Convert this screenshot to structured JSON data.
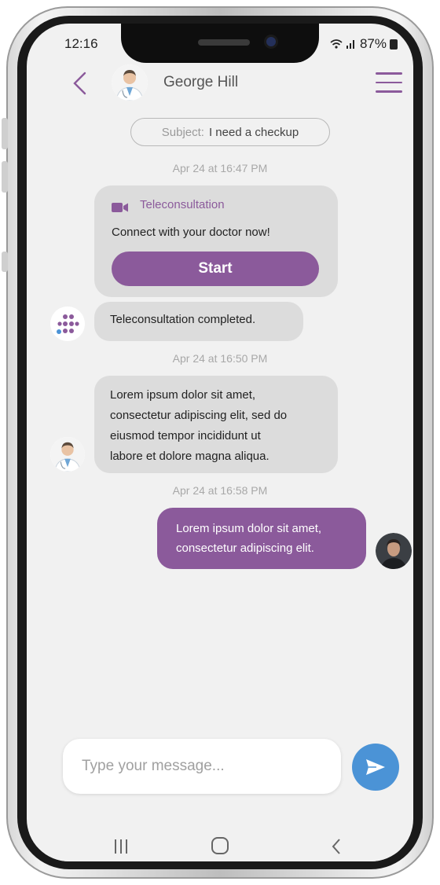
{
  "status_bar": {
    "time": "12:16",
    "battery": "87%"
  },
  "header": {
    "contact_name": "George Hill"
  },
  "subject": {
    "label": "Subject:",
    "value": "I need a checkup"
  },
  "timestamps": [
    "Apr 24 at 16:47 PM",
    "Apr 24 at 16:50 PM",
    "Apr 24 at 16:58 PM"
  ],
  "teleconsultation": {
    "title": "Teleconsultation",
    "text": "Connect with your doctor now!",
    "start_label": "Start"
  },
  "messages": [
    {
      "sender": "system",
      "text": "Teleconsultation completed."
    },
    {
      "sender": "doctor",
      "lines": [
        "Lorem ipsum dolor sit amet,",
        "consectetur adipiscing elit, sed do",
        "eiusmod tempor incididunt ut",
        "labore et dolore magna aliqua."
      ]
    },
    {
      "sender": "user",
      "lines": [
        "Lorem ipsum dolor sit amet,",
        "consectetur adipiscing elit."
      ]
    }
  ],
  "composer": {
    "placeholder": "Type your message..."
  },
  "colors": {
    "accent": "#8b5a9b",
    "send": "#4b93d6",
    "bubble_in": "#dcdcdc",
    "background": "#f1f1f1"
  },
  "icons": [
    "back-chevron-icon",
    "doctor-avatar",
    "hamburger-menu-icon",
    "video-camera-icon",
    "app-logo-icon",
    "user-avatar",
    "send-icon",
    "nav-recent-icon",
    "nav-home-icon",
    "nav-back-icon"
  ]
}
